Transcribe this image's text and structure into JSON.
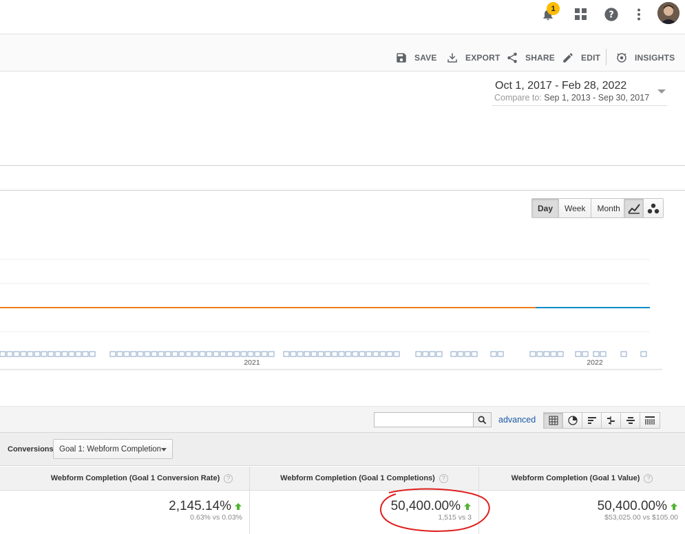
{
  "topbar": {
    "notification_count": "1",
    "icons": [
      "bell-icon",
      "apps-grid-icon",
      "help-icon",
      "more-vert-icon",
      "avatar"
    ]
  },
  "toolbar": {
    "save": "SAVE",
    "export": "EXPORT",
    "share": "SHARE",
    "edit": "EDIT",
    "insights": "INSIGHTS"
  },
  "daterange": {
    "range": "Oct 1, 2017 - Feb 28, 2022",
    "compare_label": "Compare to:",
    "compare_range": "Sep 1, 2013 - Sep 30, 2017"
  },
  "time_buttons": [
    "Day",
    "Week",
    "Month"
  ],
  "active_time": "Day",
  "chart_data": {
    "type": "line",
    "x_tick_labels": [
      "2021",
      "2022"
    ],
    "series_colors": {
      "primary": "#058dc7",
      "comparison": "#ed7e17"
    }
  },
  "table_controls": {
    "search_value": "",
    "advanced": "advanced"
  },
  "conversions": {
    "label": "Conversions",
    "selected": "Goal 1: Webform Completion"
  },
  "metrics": [
    {
      "header": "Webform Completion (Goal 1 Conversion Rate)",
      "value": "2,145.14%",
      "compare": "0.63% vs 0.03%"
    },
    {
      "header": "Webform Completion (Goal 1 Completions)",
      "value": "50,400.00%",
      "compare": "1,515 vs 3"
    },
    {
      "header": "Webform Completion (Goal 1 Value)",
      "value": "50,400.00%",
      "compare": "$53,025.00 vs $105.00"
    }
  ],
  "colors": {
    "accent_blue": "#058dc7",
    "accent_orange": "#ed7e17",
    "up_green": "#50b432",
    "annotation_red": "#e01e1e"
  }
}
